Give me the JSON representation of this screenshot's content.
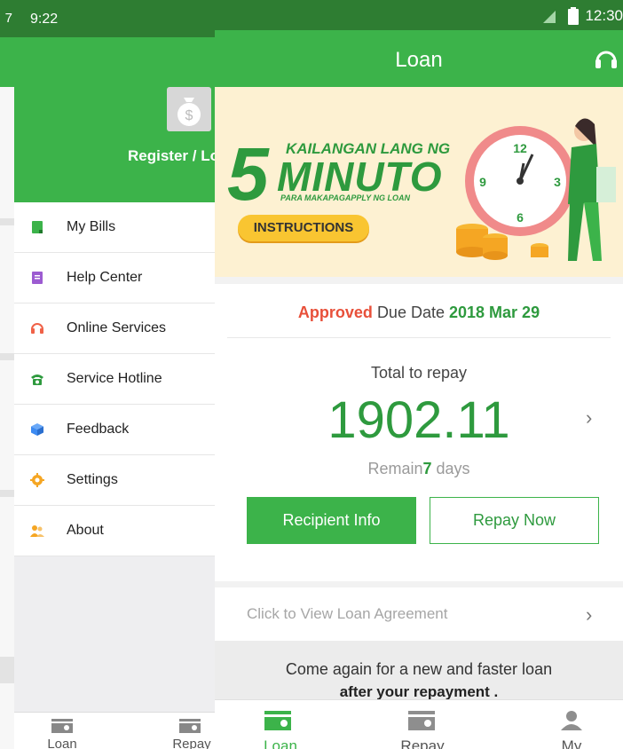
{
  "background_sliver": {
    "status_time_fragment": "7"
  },
  "drawer": {
    "status_time": "9:22",
    "register_label": "Register / Lo",
    "menu": [
      {
        "label": "My Bills",
        "icon": "bills-icon",
        "color": "#3cb34a"
      },
      {
        "label": "Help Center",
        "icon": "help-book-icon",
        "color": "#9c5bd1"
      },
      {
        "label": "Online Services",
        "icon": "headset-icon",
        "color": "#f06248"
      },
      {
        "label": "Service Hotline",
        "icon": "phone-icon",
        "color": "#2e9a3e"
      },
      {
        "label": "Feedback",
        "icon": "cube-icon",
        "color": "#3d8bf2"
      },
      {
        "label": "Settings",
        "icon": "gear-icon",
        "color": "#f5a623"
      },
      {
        "label": "About",
        "icon": "people-icon",
        "color": "#f5a623"
      }
    ],
    "nav": {
      "loan": "Loan",
      "repay": "Repay"
    }
  },
  "main": {
    "status_time": "12:30",
    "title": "Loan",
    "banner": {
      "big_number": "5",
      "line1": "KAILANGAN LANG NG",
      "line2": "MINUTO",
      "line3": "PARA MAKAPAGAPPLY NG LOAN",
      "button": "INSTRUCTIONS"
    },
    "status": {
      "approved": "Approved",
      "due_label": "Due Date",
      "due_date": "2018 Mar 29"
    },
    "total_label": "Total to repay",
    "total_amount": "1902.11",
    "remain": {
      "prefix": "Remain",
      "days": "7",
      "suffix": "days"
    },
    "recipient_button": "Recipient Info",
    "repay_button": "Repay Now",
    "agreement": "Click to View Loan Agreement",
    "promo_line1": "Come again for a new and faster loan",
    "promo_line2": "after your repayment .",
    "nav": {
      "loan": "Loan",
      "repay": "Repay",
      "my": "My"
    },
    "colors": {
      "primary": "#3cb34a",
      "status_bar": "#2e7d32",
      "approved": "#e8503a"
    }
  }
}
